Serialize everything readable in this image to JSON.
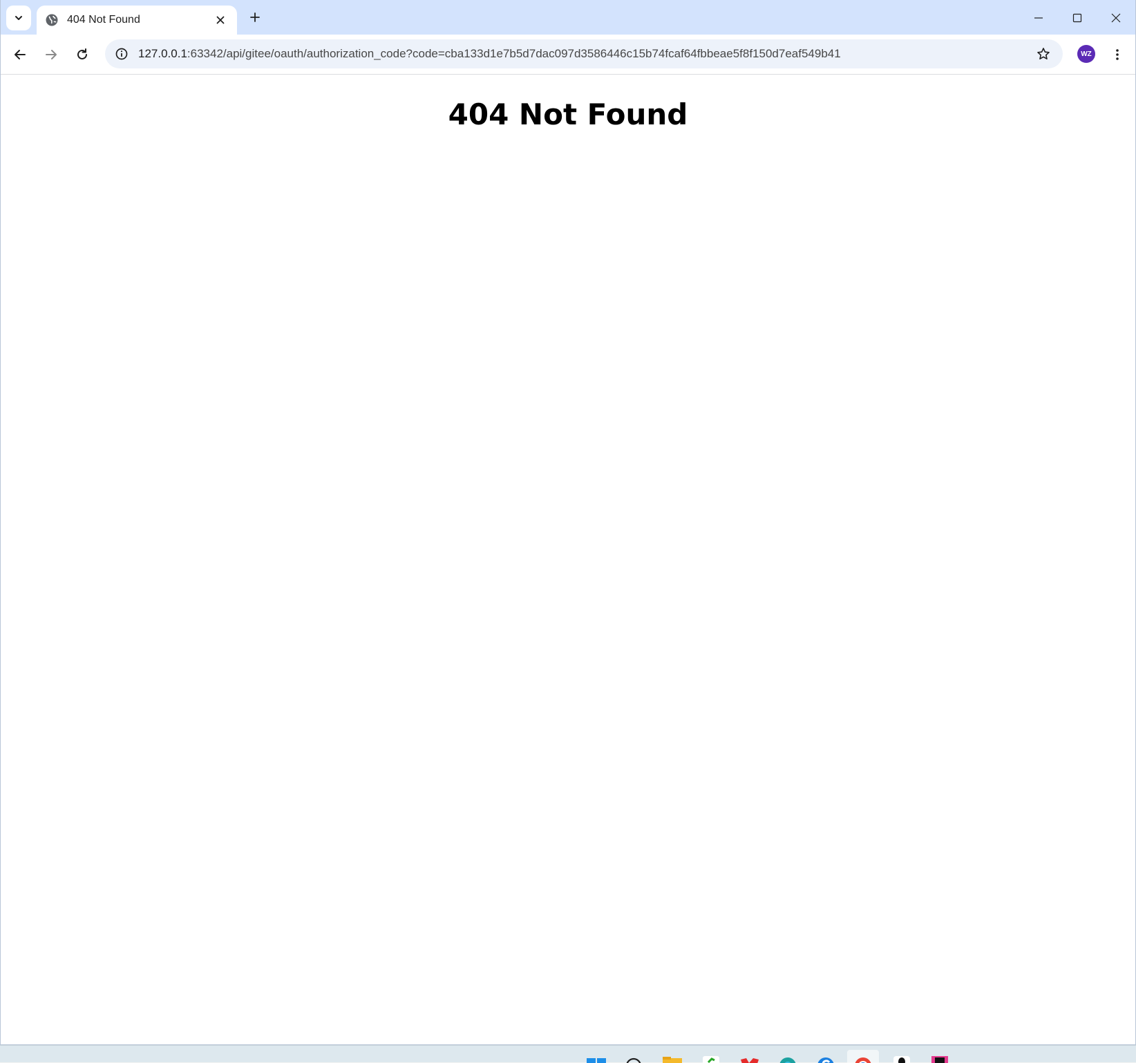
{
  "browser": {
    "tab": {
      "title": "404 Not Found",
      "favicon": "globe-icon"
    },
    "address": {
      "host": "127.0.0.1",
      "path": ":63342/api/gitee/oauth/authorization_code?code=cba133d1e7b5d7dac097d3586446c15b74fcaf64fbbeae5f8f150d7eaf549b41"
    },
    "profile_initials": "WZ",
    "colors": {
      "tabstrip": "#d3e3fd",
      "omnibox": "#edf2fa",
      "avatar": "#5b2bb5"
    }
  },
  "page": {
    "heading": "404 Not Found"
  },
  "taskbar": {
    "apps": [
      "windows-start-icon",
      "search-icon",
      "file-explorer-icon",
      "app-green-icon",
      "app-red-icon",
      "edge-icon",
      "app-blue-icon",
      "chrome-icon",
      "qq-icon",
      "intellij-icon"
    ]
  }
}
